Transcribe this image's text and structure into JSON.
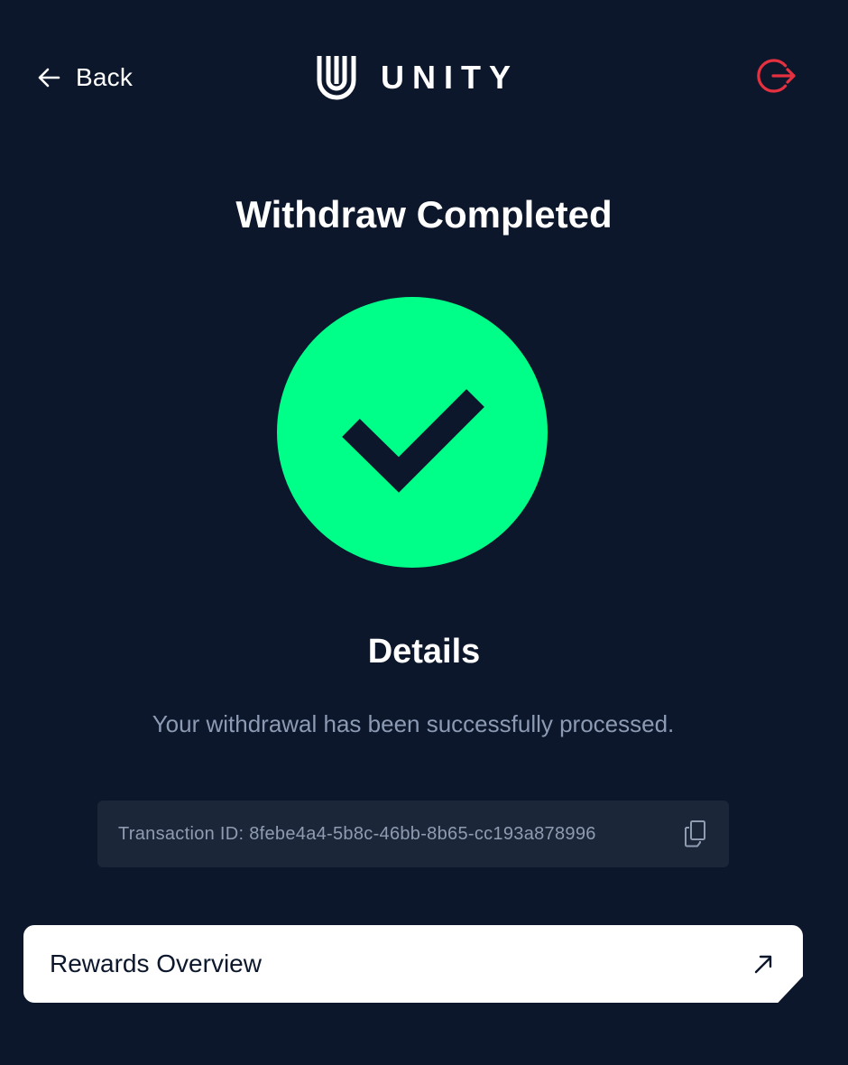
{
  "header": {
    "back_label": "Back",
    "logo_text": "UNITY",
    "logout_icon": "logout-icon",
    "logout_color": "#e5313f"
  },
  "main": {
    "title": "Withdraw Completed",
    "status_icon": "checkmark-circle-icon",
    "success_color": "#00ff88",
    "details_heading": "Details",
    "details_message": "Your withdrawal has been successfully processed.",
    "transaction_id": "Transaction ID: 8febe4a4-5b8c-46bb-8b65-cc193a878996",
    "copy_icon": "copy-icon"
  },
  "footer": {
    "rewards_label": "Rewards Overview",
    "rewards_icon": "arrow-up-right-icon"
  }
}
